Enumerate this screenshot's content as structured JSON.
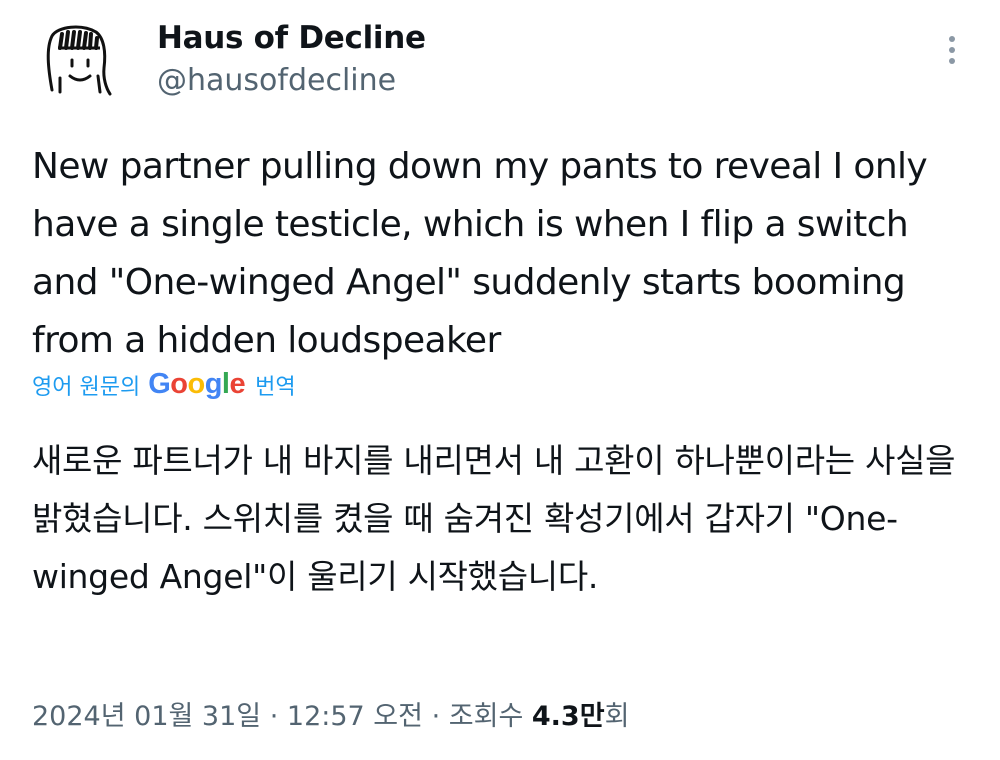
{
  "user": {
    "display_name": "Haus of Decline",
    "handle": "@hausofdecline",
    "avatar_icon": "hand-drawn-face-icon"
  },
  "tweet": {
    "text": "New partner pulling down my pants to reveal I only have a single testicle, which is when I flip a switch and \"One-winged Angel\" suddenly starts booming from a hidden loudspeaker"
  },
  "translation": {
    "prefix": "영어 원문의",
    "google_parts": [
      {
        "ch": "G",
        "color": "blue"
      },
      {
        "ch": "o",
        "color": "red"
      },
      {
        "ch": "o",
        "color": "yellow"
      },
      {
        "ch": "g",
        "color": "blue"
      },
      {
        "ch": "l",
        "color": "green"
      },
      {
        "ch": "e",
        "color": "red"
      }
    ],
    "suffix": "번역",
    "text": "새로운 파트너가 내 바지를 내리면서 내 고환이 하나뿐이라는 사실을 밝혔습니다. 스위치를 켰을 때 숨겨진 확성기에서 갑자기 \"One-winged Angel\"이 울리기 시작했습니다."
  },
  "meta": {
    "date": "2024년 01월 31일",
    "separator": "·",
    "time": "12:57 오전",
    "views_label": "조회수",
    "views_count": "4.3만",
    "views_unit": "회"
  },
  "colors": {
    "link_blue": "#1d9bf0",
    "secondary_text": "#536471",
    "primary_text": "#0f1419"
  },
  "icons": {
    "more": "more-vertical-icon"
  }
}
